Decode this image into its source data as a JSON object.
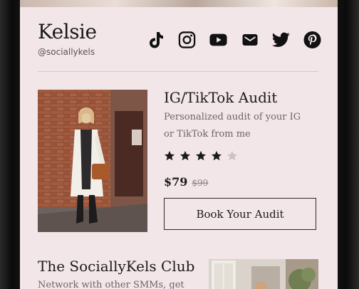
{
  "profile": {
    "name": "Kelsie",
    "handle": "@sociallykels"
  },
  "socials": [
    {
      "icon": "tiktok-icon"
    },
    {
      "icon": "instagram-icon"
    },
    {
      "icon": "youtube-icon"
    },
    {
      "icon": "email-icon"
    },
    {
      "icon": "twitter-icon"
    },
    {
      "icon": "pinterest-icon"
    }
  ],
  "products": [
    {
      "title": "IG/TikTok Audit",
      "description": "Personalized audit of your IG or TikTok from me",
      "rating": 4,
      "rating_max": 5,
      "price": "$79",
      "original_price": "$99",
      "cta": "Book Your Audit"
    },
    {
      "title": "The SociallyKels Club",
      "description": "Network with other SMMs, get"
    }
  ],
  "colors": {
    "background": "#f3e6e9",
    "text": "#1b1b1b",
    "muted": "#6b6469",
    "star_filled": "#1b1b1b",
    "star_empty": "#c9c2c6"
  }
}
